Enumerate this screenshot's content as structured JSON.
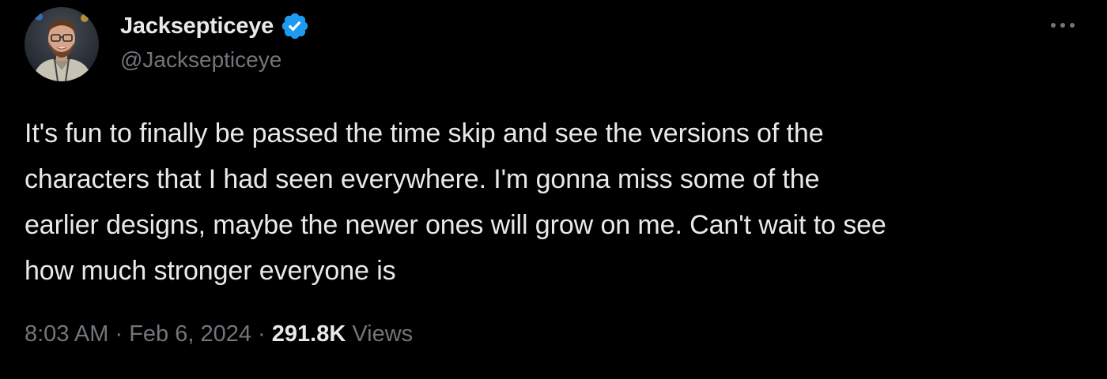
{
  "author": {
    "display_name": "Jacksepticeye",
    "handle": "@Jacksepticeye",
    "verified": true,
    "verified_color": "#1d9bf0",
    "avatar_icon": "user-avatar-icon"
  },
  "more_icon": "more-horizontal-icon",
  "tweet": {
    "text": "It's fun to finally be passed the time skip and see the versions of the\ncharacters that I had seen everywhere. I'm gonna miss some of the\nearlier designs, maybe the newer ones will grow on me. Can't wait to see\nhow much stronger everyone is"
  },
  "meta": {
    "time": "8:03 AM",
    "separator": " · ",
    "date": "Feb 6, 2024",
    "views_count": "291.8K",
    "views_label": " Views"
  },
  "colors": {
    "background": "#000000",
    "primary_text": "#e7e9ea",
    "secondary_text": "#71767b"
  }
}
